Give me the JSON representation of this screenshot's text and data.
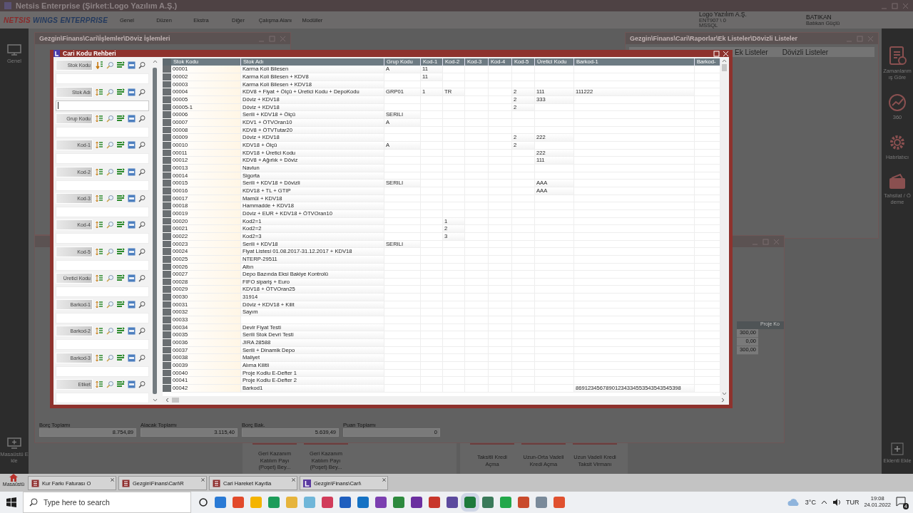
{
  "app": {
    "title": "Netsis Enterprise (Şirket:Logo Yazılım A.Ş.)",
    "logo": {
      "brand": "NETSIS",
      "product": "WINGS ENTERPRISE"
    },
    "menu": [
      "Genel",
      "Düzen",
      "Ekstra",
      "Diğer",
      "Çalışma Alanı",
      "Modüller"
    ],
    "company": {
      "name": "Logo Yazılım A.Ş.",
      "server": "ENT907 \\ 0",
      "database": "MSSQL"
    },
    "user": {
      "name": "BATIKAN",
      "full_name": "Batıkan Güçlü"
    }
  },
  "left_sidebar": {
    "items": [
      {
        "label": "Genel"
      }
    ],
    "footer": "Masaüstü Ekle"
  },
  "right_sidebar": {
    "items": [
      {
        "label": "Zamanlanmış Göre",
        "kind": "schedule"
      },
      {
        "label": "360",
        "kind": "chart"
      },
      {
        "label": "Hatırlatıcı",
        "kind": "settings"
      },
      {
        "label": "Tahsilat / Ödeme",
        "kind": "payment"
      }
    ],
    "footer": "Eklenti Ekle"
  },
  "background_windows": [
    {
      "title": "Gezgin\\Finans\\Cari\\İşlemler\\Döviz İşlemleri"
    },
    {
      "title": "Gezgin\\Finans\\Cari\\Raporlar\\Ek Listeler\\Dövizli Listeler",
      "breadcrumb": [
        "Ek Listeler",
        "Dövizli Listeler"
      ]
    }
  ],
  "account_window": {
    "column": "Proje Ko",
    "values": [
      "300,00",
      "0,00",
      "300,00"
    ],
    "totals": [
      {
        "label": "Borç Toplamı",
        "value": "8.754,89"
      },
      {
        "label": "Alacak Toplamı",
        "value": "3.115,40"
      },
      {
        "label": "Borç Bak.",
        "value": "5.639,49"
      },
      {
        "label": "Puan Toplamı",
        "value": "0"
      }
    ]
  },
  "action_groups": [
    [
      "Geri Kazanım Katılım Payı (Poşet) Bey...",
      "Geri Kazanım Katılım Payı (Poşet) Bey..."
    ],
    [
      "Taksitli Kredi Açma",
      "Uzun-Orta Vadeli Kredi Açma",
      "Uzun Vadeli Kredi Taksit Virmanı"
    ]
  ],
  "dialog": {
    "title": "Cari Kodu Rehberi",
    "filters": [
      {
        "label": "Stok Kodu",
        "sorted": true,
        "focused": false
      },
      {
        "label": "Stok Adı",
        "sorted": false,
        "focused": true
      },
      {
        "label": "Grup Kodu",
        "sorted": false,
        "focused": false
      },
      {
        "label": "Kod-1",
        "sorted": false,
        "focused": false
      },
      {
        "label": "Kod-2",
        "sorted": false,
        "focused": false
      },
      {
        "label": "Kod-3",
        "sorted": false,
        "focused": false
      },
      {
        "label": "Kod-4",
        "sorted": false,
        "focused": false
      },
      {
        "label": "Kod-5",
        "sorted": false,
        "focused": false
      },
      {
        "label": "Üretici Kodu",
        "sorted": false,
        "focused": false
      },
      {
        "label": "Barkod-1",
        "sorted": false,
        "focused": false
      },
      {
        "label": "Barkod-2",
        "sorted": false,
        "focused": false
      },
      {
        "label": "Barkod-3",
        "sorted": false,
        "focused": false
      },
      {
        "label": "Etiket",
        "sorted": false,
        "focused": false
      }
    ],
    "columns": [
      "Stok Kodu",
      "Stok Adı",
      "Grup Kodu",
      "Kod-1",
      "Kod-2",
      "Kod-3",
      "Kod-4",
      "Kod-5",
      "Üretici Kodu",
      "Barkod-1",
      "Barkod-"
    ],
    "rows": [
      {
        "stok_kodu": "00001",
        "stok_adi": "Karma Koli Bilesen",
        "grup_kodu": "A",
        "kod_1": "11"
      },
      {
        "stok_kodu": "00002",
        "stok_adi": "Karma Koli Bilesen + KDV8",
        "kod_1": "11"
      },
      {
        "stok_kodu": "00003",
        "stok_adi": "Karma Koli Bilesen + KDV18"
      },
      {
        "stok_kodu": "00004",
        "stok_adi": "KDV8 + Fiyat + Ölçü + Üretici Kodu + DepoKodu",
        "grup_kodu": "GRP01",
        "kod_1": "1",
        "kod_2": "TR",
        "kod_5": "2",
        "uretici_kodu": "111",
        "barkod_1": "111222"
      },
      {
        "stok_kodu": "00005",
        "stok_adi": "Döviz + KDV18",
        "kod_5": "2",
        "uretici_kodu": "333"
      },
      {
        "stok_kodu": "00005-1",
        "stok_adi": "Döviz + KDV18",
        "kod_5": "2"
      },
      {
        "stok_kodu": "00006",
        "stok_adi": "Serili + KDV18 + Ölçü",
        "grup_kodu": "SERILI"
      },
      {
        "stok_kodu": "00007",
        "stok_adi": "KDV1 + ÖTVOran10",
        "grup_kodu": "A"
      },
      {
        "stok_kodu": "00008",
        "stok_adi": "KDV8 + ÖTVTutar20"
      },
      {
        "stok_kodu": "00009",
        "stok_adi": "Döviz + KDV18",
        "kod_5": "2",
        "uretici_kodu": "222"
      },
      {
        "stok_kodu": "00010",
        "stok_adi": "KDV18 + Ölçü",
        "grup_kodu": "A",
        "kod_5": "2"
      },
      {
        "stok_kodu": "00011",
        "stok_adi": "KDV18 + Üretici Kodu",
        "uretici_kodu": "222"
      },
      {
        "stok_kodu": "00012",
        "stok_adi": "KDV8 + Ağırlık + Döviz",
        "uretici_kodu": "111"
      },
      {
        "stok_kodu": "00013",
        "stok_adi": "Navlun"
      },
      {
        "stok_kodu": "00014",
        "stok_adi": "Sigorta"
      },
      {
        "stok_kodu": "00015",
        "stok_adi": "Serili + KDV18 + Dövizli",
        "grup_kodu": "SERILI",
        "uretici_kodu": "AAA"
      },
      {
        "stok_kodu": "00016",
        "stok_adi": "KDV18 + TL + GTIP",
        "uretici_kodu": "AAA"
      },
      {
        "stok_kodu": "00017",
        "stok_adi": "Mamül + KDV18"
      },
      {
        "stok_kodu": "00018",
        "stok_adi": "Hammadde + KDV18"
      },
      {
        "stok_kodu": "00019",
        "stok_adi": "Döviz + EUR + KDV18 + ÖTVOran10"
      },
      {
        "stok_kodu": "00020",
        "stok_adi": "Kod2=1",
        "kod_2": "1"
      },
      {
        "stok_kodu": "00021",
        "stok_adi": "Kod2=2",
        "kod_2": "2"
      },
      {
        "stok_kodu": "00022",
        "stok_adi": "Kod2=3",
        "kod_2": "3"
      },
      {
        "stok_kodu": "00023",
        "stok_adi": "Serili + KDV18",
        "grup_kodu": "SERILI"
      },
      {
        "stok_kodu": "00024",
        "stok_adi": "Fiyat Listesi 01.08.2017-31.12.2017 + KDV18"
      },
      {
        "stok_kodu": "00025",
        "stok_adi": "NTERP-29511"
      },
      {
        "stok_kodu": "00026",
        "stok_adi": "Altın"
      },
      {
        "stok_kodu": "00027",
        "stok_adi": "Depo Bazında Eksi Bakiye Kontrolü"
      },
      {
        "stok_kodu": "00028",
        "stok_adi": "FIFO sipariş + Euro"
      },
      {
        "stok_kodu": "00029",
        "stok_adi": "KDV18 + ÖTVOran25"
      },
      {
        "stok_kodu": "00030",
        "stok_adi": "31914"
      },
      {
        "stok_kodu": "00031",
        "stok_adi": "Döviz + KDV18 + Kilit"
      },
      {
        "stok_kodu": "00032",
        "stok_adi": "Sayım"
      },
      {
        "stok_kodu": "00033"
      },
      {
        "stok_kodu": "00034",
        "stok_adi": "Devir Fiyat Testi"
      },
      {
        "stok_kodu": "00035",
        "stok_adi": "Serili Stok Devri Testi"
      },
      {
        "stok_kodu": "00036",
        "stok_adi": "JIRA 28588"
      },
      {
        "stok_kodu": "00037",
        "stok_adi": "Serili + Dinamik Depo"
      },
      {
        "stok_kodu": "00038",
        "stok_adi": "Maliyet"
      },
      {
        "stok_kodu": "00039",
        "stok_adi": "Alıma Kilitli"
      },
      {
        "stok_kodu": "00040",
        "stok_adi": "Proje Kodlu E-Defter 1"
      },
      {
        "stok_kodu": "00041",
        "stok_adi": "Proje Kodlu E-Defter 2"
      },
      {
        "stok_kodu": "00042",
        "stok_adi": "Barkod1",
        "barkod_1": "86912345678901234334553543543545398"
      }
    ]
  },
  "app_tabs": [
    {
      "label": "Masaüstü",
      "kind": "home"
    },
    {
      "label": "Kur Farkı Faturası O",
      "kind": "document"
    },
    {
      "label": "Gezgin\\Finans\\Cari\\R",
      "kind": "document"
    },
    {
      "label": "Cari Hareket Kayıtla",
      "kind": "document"
    },
    {
      "label": "Gezgin\\Finans\\Cari\\",
      "kind": "logo"
    }
  ],
  "taskbar": {
    "search_placeholder": "Type here to search",
    "weather": "3°C",
    "language": "TUR",
    "time": "19:08",
    "date": "24.01.2022",
    "notifications": "4"
  }
}
